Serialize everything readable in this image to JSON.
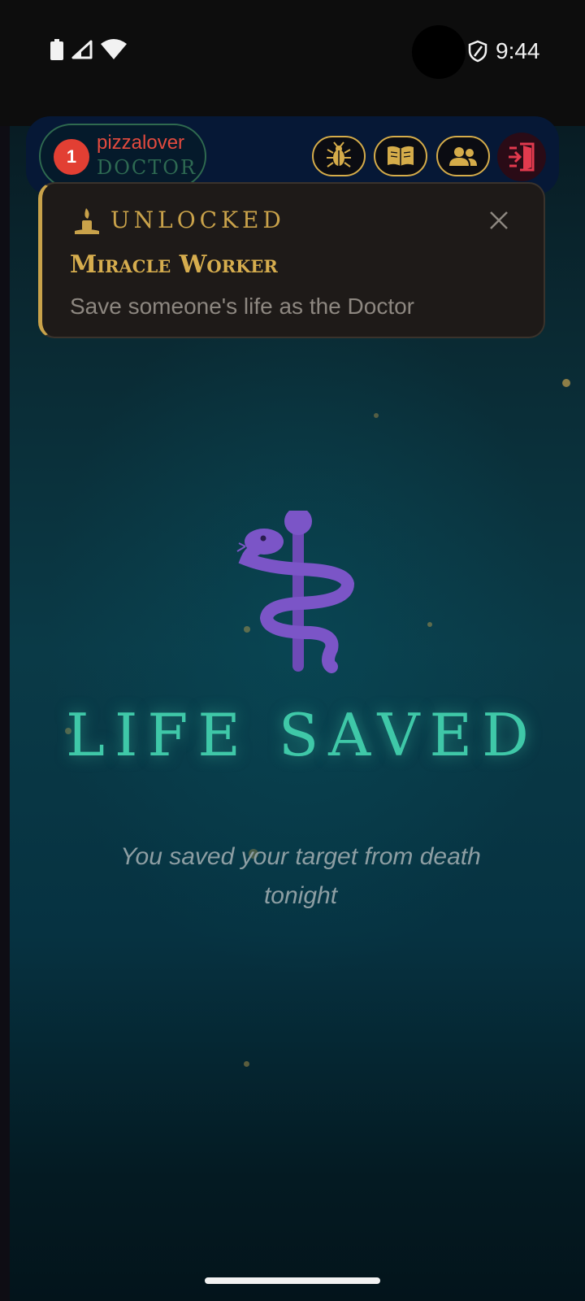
{
  "status_bar": {
    "time": "9:44",
    "icons": [
      "battery-icon",
      "signal-icon",
      "wifi-icon",
      "shield-icon"
    ]
  },
  "player": {
    "number": "1",
    "name": "pizzalover",
    "role": "DOCTOR"
  },
  "header_buttons": [
    "bug-icon",
    "book-icon",
    "people-icon",
    "exit-door-icon"
  ],
  "achievement": {
    "kicker": "UNLOCKED",
    "title": "Miracle Worker",
    "description": "Save someone's life as the Doctor"
  },
  "main": {
    "icon": "caduceus-icon",
    "title": "LIFE SAVED",
    "subtitle": "You saved your target from death tonight"
  },
  "colors": {
    "accent_gold": "#c9a24a",
    "title_teal": "#3fc8a8",
    "player_red": "#e23f33",
    "exit_red": "#e23a4e",
    "caduceus_purple": "#7b55c7"
  }
}
